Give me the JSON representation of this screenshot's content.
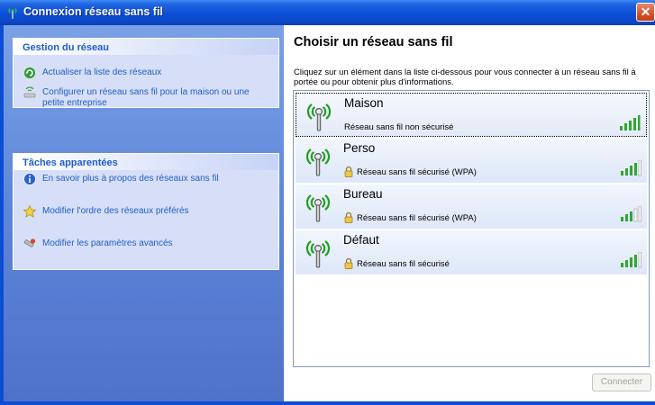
{
  "window": {
    "title": "Connexion réseau sans fil",
    "close_label": "✕"
  },
  "sidebar": {
    "network_tasks": {
      "header": "Gestion du réseau",
      "items": [
        {
          "label": "Actualiser la liste des réseaux",
          "icon": "refresh-icon"
        },
        {
          "label": "Configurer un réseau sans fil pour la maison ou une petite entreprise",
          "icon": "setup-wizard-icon"
        }
      ]
    },
    "related_tasks": {
      "header": "Tâches apparentées",
      "items": [
        {
          "label": "En savoir plus à propos des réseaux sans fil",
          "icon": "info-icon"
        },
        {
          "label": "Modifier l'ordre des réseaux préférés",
          "icon": "star-icon"
        },
        {
          "label": "Modifier les paramètres avancés",
          "icon": "settings-icon"
        }
      ]
    }
  },
  "main": {
    "title": "Choisir un réseau sans fil",
    "description": "Cliquez sur un élément dans la liste ci-dessous pour vous connecter à un réseau sans fil à portée ou pour obtenir plus d'informations.",
    "networks": [
      {
        "name": "Maison",
        "status": "Réseau sans fil non sécurisé",
        "secured": false,
        "signal_bars": 5,
        "selected": true
      },
      {
        "name": "Perso",
        "status": "Réseau sans fil sécurisé (WPA)",
        "secured": true,
        "signal_bars": 4,
        "selected": false
      },
      {
        "name": "Bureau",
        "status": "Réseau sans fil sécurisé (WPA)",
        "secured": true,
        "signal_bars": 3,
        "selected": false
      },
      {
        "name": "Défaut",
        "status": "Réseau sans fil sécurisé",
        "secured": true,
        "signal_bars": 4,
        "selected": false
      }
    ],
    "connect_label": "Connecter"
  },
  "colors": {
    "accent_blue": "#215dc6",
    "signal_green": "#2fa82f",
    "titlebar": "#0a4fd6"
  }
}
